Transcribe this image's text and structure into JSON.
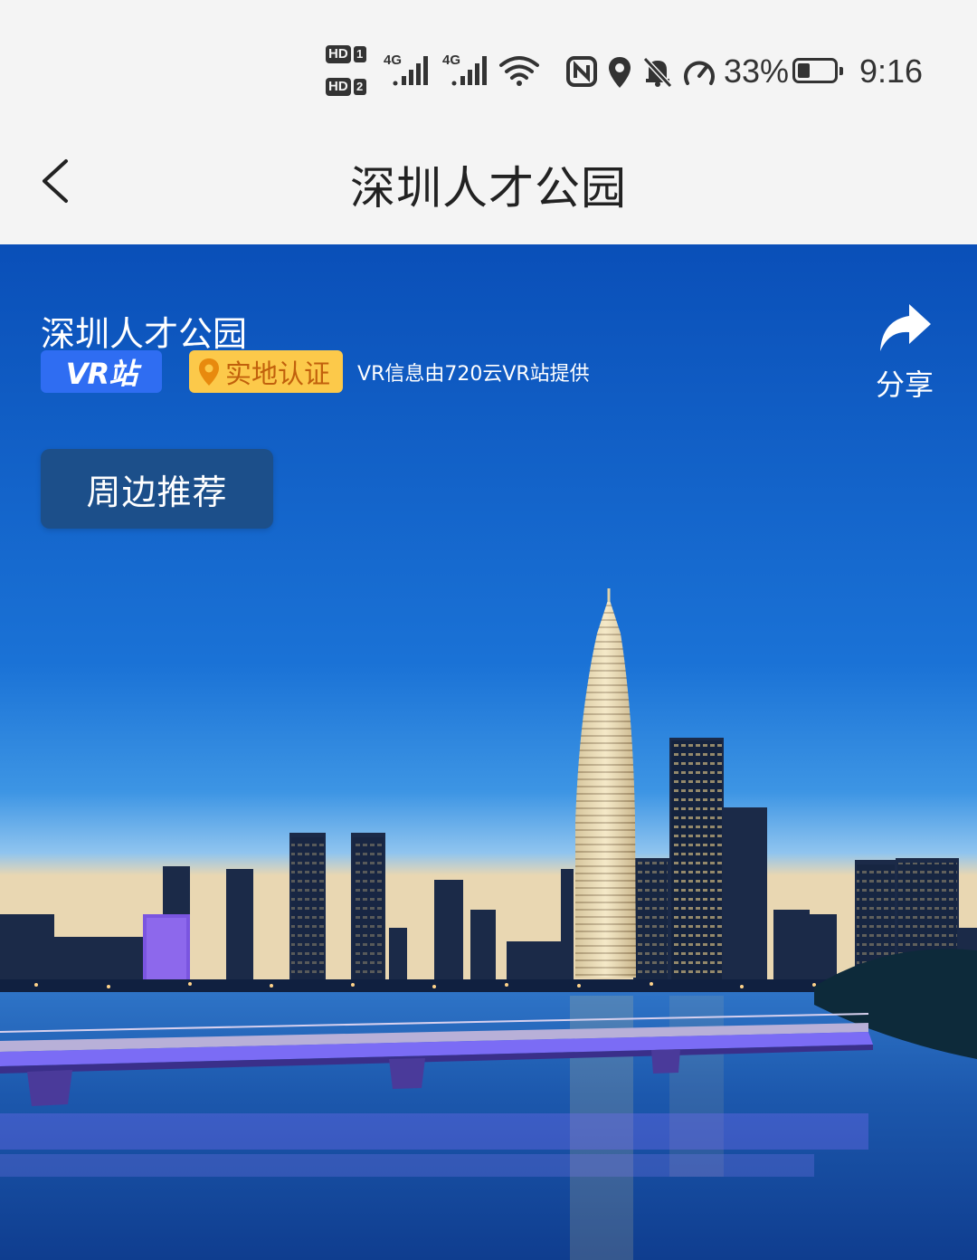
{
  "status_bar": {
    "hd1": "HD",
    "sim1": "1",
    "hd2": "HD",
    "sim2": "2",
    "net1": "4G",
    "net2": "4G",
    "battery_percent": "33%",
    "battery_level": 0.33,
    "time": "9:16",
    "icons": [
      "signal-icon",
      "wifi-icon",
      "nfc-icon",
      "location-icon",
      "mute-bell-icon",
      "speed-icon",
      "battery-icon"
    ]
  },
  "nav": {
    "title": "深圳人才公园",
    "back_icon": "chevron-left-icon"
  },
  "hero": {
    "place_name": "深圳人才公园",
    "vr_badge": "VR站",
    "verify_badge": "实地认证",
    "provider_note": "VR信息由720云VR站提供",
    "share_label": "分享",
    "nearby_button": "周边推荐"
  },
  "colors": {
    "sky_top": "#0a4fb8",
    "sky_horizon": "#5aa6e8",
    "vr_blue": "#2f6df2",
    "verify_yellow": "#fcc94a",
    "nearby_button": "#1c4f8a",
    "bridge_light": "#7b6cf5"
  }
}
